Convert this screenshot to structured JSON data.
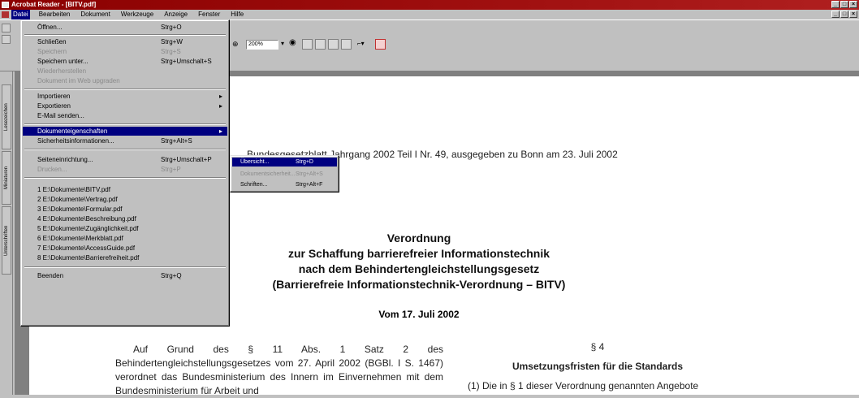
{
  "window": {
    "title": "Acrobat Reader - [BITV.pdf]",
    "caption_min": "_",
    "caption_max": "□",
    "caption_close": "×"
  },
  "menubar": {
    "items": [
      "Datei",
      "Bearbeiten",
      "Dokument",
      "Werkzeuge",
      "Anzeige",
      "Fenster",
      "Hilfe"
    ]
  },
  "toolbar": {
    "zoom_value": "200%",
    "zoom_arrow": "▾"
  },
  "nav_tabs": [
    "Lesezeichen",
    "Miniaturen",
    "Unterschriften"
  ],
  "file_menu": {
    "items": [
      {
        "label": "Öffnen...",
        "shortcut": "Strg+O",
        "state": "normal"
      },
      {
        "label": "Schließen",
        "shortcut": "Strg+W",
        "state": "normal"
      },
      {
        "label": "Speichern",
        "shortcut": "Strg+S",
        "state": "disabled"
      },
      {
        "label": "Speichern unter...",
        "shortcut": "Strg+Umschalt+S",
        "state": "normal"
      },
      {
        "label": "Wiederherstellen",
        "shortcut": "",
        "state": "disabled"
      },
      {
        "label": "Dokument im Web upgraden",
        "shortcut": "",
        "state": "disabled"
      },
      {
        "label": "Importieren",
        "shortcut": "",
        "state": "submenu"
      },
      {
        "label": "Exportieren",
        "shortcut": "",
        "state": "submenu"
      },
      {
        "label": "E-Mail senden...",
        "shortcut": "",
        "state": "normal"
      },
      {
        "label": "Dokumenteigenschaften",
        "shortcut": "",
        "state": "highlighted"
      },
      {
        "label": "Sicherheitsinformationen...",
        "shortcut": "Strg+Alt+S",
        "state": "normal"
      },
      {
        "label": "Seiteneinrichtung...",
        "shortcut": "Strg+Umschalt+P",
        "state": "normal"
      },
      {
        "label": "Drucken...",
        "shortcut": "Strg+P",
        "state": "disabled"
      },
      {
        "label": "1 E:\\Dokumente\\BITV.pdf",
        "shortcut": "",
        "state": "normal"
      },
      {
        "label": "2 E:\\Dokumente\\Vertrag.pdf",
        "shortcut": "",
        "state": "normal"
      },
      {
        "label": "3 E:\\Dokumente\\Formular.pdf",
        "shortcut": "",
        "state": "normal"
      },
      {
        "label": "4 E:\\Dokumente\\Beschreibung.pdf",
        "shortcut": "",
        "state": "normal"
      },
      {
        "label": "5 E:\\Dokumente\\Zugänglichkeit.pdf",
        "shortcut": "",
        "state": "normal"
      },
      {
        "label": "6 E:\\Dokumente\\Merkblatt.pdf",
        "shortcut": "",
        "state": "normal"
      },
      {
        "label": "7 E:\\Dokumente\\AccessGuide.pdf",
        "shortcut": "",
        "state": "normal"
      },
      {
        "label": "8 E:\\Dokumente\\Barrierefreiheit.pdf",
        "shortcut": "",
        "state": "normal"
      },
      {
        "label": "Beenden",
        "shortcut": "Strg+Q",
        "state": "normal"
      }
    ],
    "submenu_arrow": "▸"
  },
  "properties_submenu": {
    "items": [
      {
        "label": "Übersicht...",
        "shortcut": "Strg+D",
        "state": "highlighted"
      },
      {
        "label": "Dokumentsicherheit...",
        "shortcut": "Strg+Alt+S",
        "state": "disabled"
      },
      {
        "label": "Schriften...",
        "shortcut": "Strg+Alt+F",
        "state": "normal"
      }
    ]
  },
  "document": {
    "header": "Bundesgesetzblatt Jahrgang 2002 Teil I Nr. 49, ausgegeben zu Bonn am 23. Juli 2002",
    "title_lines": [
      "Verordnung",
      "zur Schaffung barrierefreier Informationstechnik",
      "nach dem Behindertengleichstellungsgesetz",
      "(Barrierefreie Informationstechnik-Verordnung – BITV)"
    ],
    "date": "Vom 17. Juli 2002",
    "left_paragraph": "Auf Grund des § 11 Abs. 1 Satz 2 des Behindertengleichstellungsgesetzes vom 27. April 2002 (BGBl. I S. 1467) verordnet das Bundesministerium des Innern im Einvernehmen mit dem Bundesministerium für Arbeit und",
    "section_number": "§ 4",
    "section_title": "Umsetzungsfristen für die Standards",
    "section_text": "(1) Die in § 1 dieser Verordnung genannten Angebote"
  },
  "colors": {
    "titlebar": "#8b0000",
    "highlight": "#000080",
    "chrome": "#c0c0c0"
  }
}
